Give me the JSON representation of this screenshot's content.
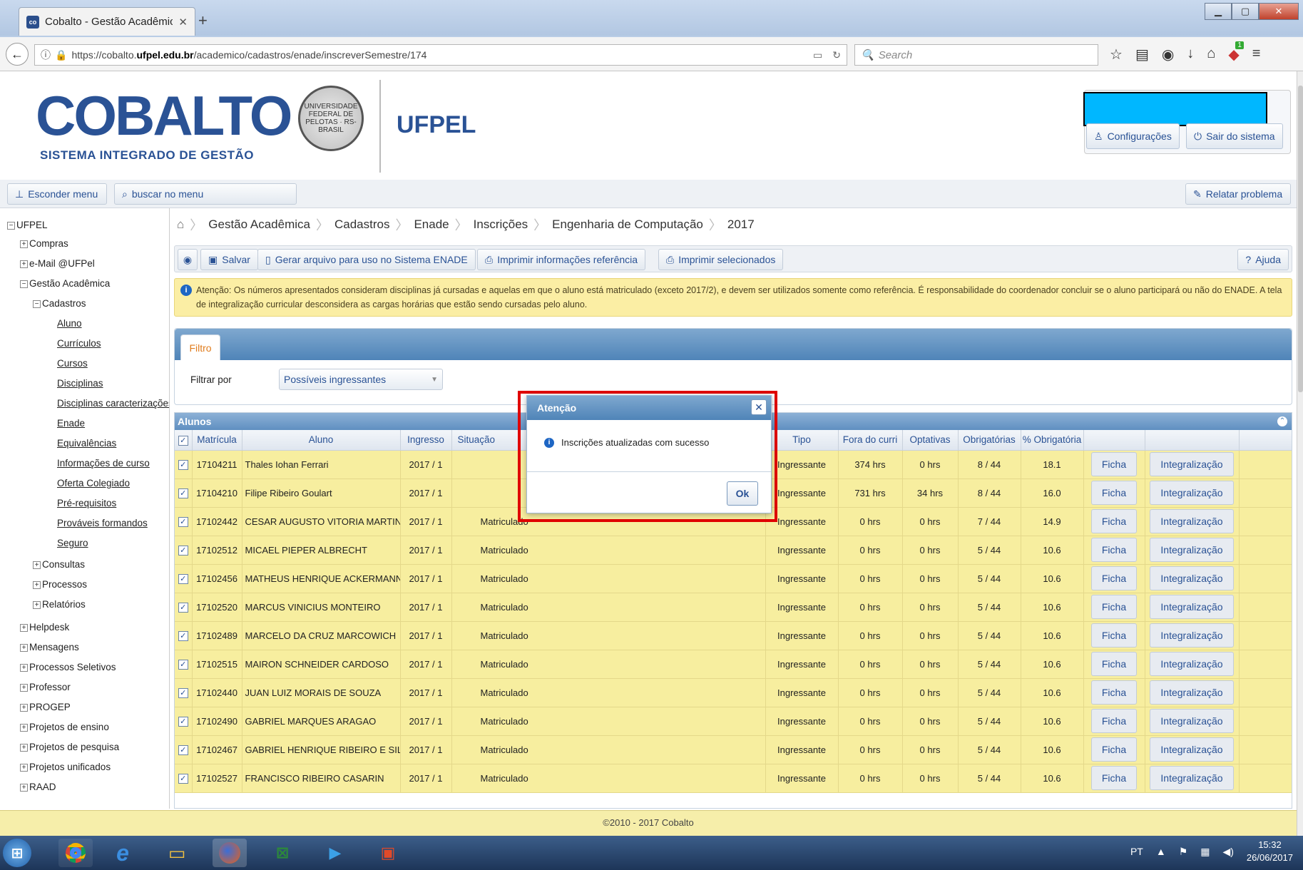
{
  "browser": {
    "tab_title": "Cobalto - Gestão Acadêmica",
    "favicon": "co",
    "url_scheme": "https://cobalto.",
    "url_domain": "ufpel.edu.br",
    "url_path": "/academico/cadastros/enade/inscreverSemestre/174",
    "search_placeholder": "Search",
    "addon_badge": "1"
  },
  "header": {
    "logo": "COBALTO",
    "logo_sub": "SISTEMA INTEGRADO DE GESTÃO",
    "seal": "UNIVERSIDADE FEDERAL DE PELOTAS · RS-BRASIL",
    "org": "UFPEL",
    "config": "Configurações",
    "logout": "Sair do sistema"
  },
  "menubar": {
    "hide_menu": "Esconder menu",
    "search_menu": "buscar no menu",
    "report": "Relatar problema"
  },
  "sidebar": {
    "root": "UFPEL",
    "items": {
      "compras": "Compras",
      "email": "e-Mail @UFPel",
      "gestao": "Gestão Acadêmica",
      "cadastros": "Cadastros",
      "aluno": "Aluno",
      "curriculos": "Currículos",
      "cursos": "Cursos",
      "disciplinas": "Disciplinas",
      "disc_car": "Disciplinas caracterizações",
      "enade": "Enade",
      "equiv": "Equivalências",
      "info": "Informações de curso",
      "oferta": "Oferta Colegiado",
      "prereq": "Pré-requisitos",
      "provaveis": "Prováveis formandos",
      "seguro": "Seguro",
      "consultas": "Consultas",
      "processos": "Processos",
      "relatorios": "Relatórios",
      "helpdesk": "Helpdesk",
      "mensagens": "Mensagens",
      "seletivos": "Processos Seletivos",
      "professor": "Professor",
      "progep": "PROGEP",
      "ensino": "Projetos de ensino",
      "pesquisa": "Projetos de pesquisa",
      "unificados": "Projetos unificados",
      "raad": "RAAD"
    }
  },
  "breadcrumb": [
    "Gestão Acadêmica",
    "Cadastros",
    "Enade",
    "Inscrições",
    "Engenharia de Computação",
    "2017"
  ],
  "toolbar": {
    "save": "Salvar",
    "gen": "Gerar arquivo para uso no Sistema ENADE",
    "print_ref": "Imprimir informações referência",
    "print_sel": "Imprimir selecionados",
    "help": "Ajuda"
  },
  "notice": "Atenção: Os números apresentados consideram disciplinas já cursadas e aquelas em que o aluno está matriculado (exceto 2017/2), e devem ser utilizados somente como referência. É responsabilidade do coordenador concluir se o aluno participará ou não do ENADE. A tela de integralização curricular desconsidera as cargas horárias que estão sendo cursadas pelo aluno.",
  "filter": {
    "tab": "Filtro",
    "label": "Filtrar por",
    "value": "Possíveis ingressantes"
  },
  "grid": {
    "title": "Alunos",
    "columns": {
      "matricula": "Matrícula",
      "aluno": "Aluno",
      "ingresso": "Ingresso",
      "situacao": "Situação",
      "tipo": "Tipo",
      "fora": "Fora do curri",
      "optativas": "Optativas",
      "obrig": "Obrigatórias",
      "pct": "% Obrigatória"
    },
    "btn_ficha": "Ficha",
    "btn_integ": "Integralização",
    "rows": [
      {
        "m": "17104211",
        "a": "Thales Iohan Ferrari",
        "i": "2017 / 1",
        "s": "",
        "t": "Ingressante",
        "f": "374 hrs",
        "o": "0 hrs",
        "ob": "8 / 44",
        "p": "18.1"
      },
      {
        "m": "17104210",
        "a": "Filipe Ribeiro Goulart",
        "i": "2017 / 1",
        "s": "",
        "t": "Ingressante",
        "f": "731 hrs",
        "o": "34 hrs",
        "ob": "8 / 44",
        "p": "16.0"
      },
      {
        "m": "17102442",
        "a": "CESAR AUGUSTO VITORIA MARTINS JUNIOR",
        "i": "2017 / 1",
        "s": "Matriculado",
        "t": "Ingressante",
        "f": "0 hrs",
        "o": "0 hrs",
        "ob": "7 / 44",
        "p": "14.9"
      },
      {
        "m": "17102512",
        "a": "MICAEL PIEPER ALBRECHT",
        "i": "2017 / 1",
        "s": "Matriculado",
        "t": "Ingressante",
        "f": "0 hrs",
        "o": "0 hrs",
        "ob": "5 / 44",
        "p": "10.6"
      },
      {
        "m": "17102456",
        "a": "MATHEUS HENRIQUE ACKERMANN",
        "i": "2017 / 1",
        "s": "Matriculado",
        "t": "Ingressante",
        "f": "0 hrs",
        "o": "0 hrs",
        "ob": "5 / 44",
        "p": "10.6"
      },
      {
        "m": "17102520",
        "a": "MARCUS VINICIUS MONTEIRO",
        "i": "2017 / 1",
        "s": "Matriculado",
        "t": "Ingressante",
        "f": "0 hrs",
        "o": "0 hrs",
        "ob": "5 / 44",
        "p": "10.6"
      },
      {
        "m": "17102489",
        "a": "MARCELO DA CRUZ MARCOWICH",
        "i": "2017 / 1",
        "s": "Matriculado",
        "t": "Ingressante",
        "f": "0 hrs",
        "o": "0 hrs",
        "ob": "5 / 44",
        "p": "10.6"
      },
      {
        "m": "17102515",
        "a": "MAIRON SCHNEIDER CARDOSO",
        "i": "2017 / 1",
        "s": "Matriculado",
        "t": "Ingressante",
        "f": "0 hrs",
        "o": "0 hrs",
        "ob": "5 / 44",
        "p": "10.6"
      },
      {
        "m": "17102440",
        "a": "JUAN LUIZ MORAIS DE SOUZA",
        "i": "2017 / 1",
        "s": "Matriculado",
        "t": "Ingressante",
        "f": "0 hrs",
        "o": "0 hrs",
        "ob": "5 / 44",
        "p": "10.6"
      },
      {
        "m": "17102490",
        "a": "GABRIEL MARQUES ARAGAO",
        "i": "2017 / 1",
        "s": "Matriculado",
        "t": "Ingressante",
        "f": "0 hrs",
        "o": "0 hrs",
        "ob": "5 / 44",
        "p": "10.6"
      },
      {
        "m": "17102467",
        "a": "GABRIEL HENRIQUE RIBEIRO E SILVA",
        "i": "2017 / 1",
        "s": "Matriculado",
        "t": "Ingressante",
        "f": "0 hrs",
        "o": "0 hrs",
        "ob": "5 / 44",
        "p": "10.6"
      },
      {
        "m": "17102527",
        "a": "FRANCISCO RIBEIRO CASARIN",
        "i": "2017 / 1",
        "s": "Matriculado",
        "t": "Ingressante",
        "f": "0 hrs",
        "o": "0 hrs",
        "ob": "5 / 44",
        "p": "10.6"
      }
    ]
  },
  "dialog": {
    "title": "Atenção",
    "message": "Inscrições atualizadas com sucesso",
    "ok": "Ok"
  },
  "footer": "©2010 - 2017 Cobalto",
  "taskbar": {
    "lang": "PT",
    "time": "15:32",
    "date": "26/06/2017"
  }
}
